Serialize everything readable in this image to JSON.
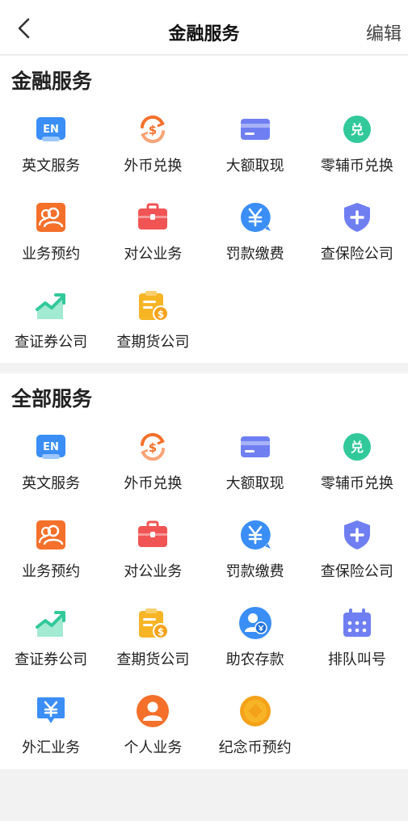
{
  "header": {
    "title": "金融服务",
    "edit_label": "编辑"
  },
  "sections": [
    {
      "title": "金融服务",
      "items": [
        {
          "label": "英文服务",
          "icon": "en-icon"
        },
        {
          "label": "外币兑换",
          "icon": "currency-exchange-icon"
        },
        {
          "label": "大额取现",
          "icon": "card-icon"
        },
        {
          "label": "零辅币兑换",
          "icon": "coin-exchange-icon"
        },
        {
          "label": "业务预约",
          "icon": "users-icon"
        },
        {
          "label": "对公业务",
          "icon": "briefcase-icon"
        },
        {
          "label": "罚款缴费",
          "icon": "yen-chat-icon"
        },
        {
          "label": "查保险公司",
          "icon": "shield-plus-icon"
        },
        {
          "label": "查证券公司",
          "icon": "trend-up-icon"
        },
        {
          "label": "查期货公司",
          "icon": "clipboard-dollar-icon"
        }
      ]
    },
    {
      "title": "全部服务",
      "items": [
        {
          "label": "英文服务",
          "icon": "en-icon"
        },
        {
          "label": "外币兑换",
          "icon": "currency-exchange-icon"
        },
        {
          "label": "大额取现",
          "icon": "card-icon"
        },
        {
          "label": "零辅币兑换",
          "icon": "coin-exchange-icon"
        },
        {
          "label": "业务预约",
          "icon": "users-icon"
        },
        {
          "label": "对公业务",
          "icon": "briefcase-icon"
        },
        {
          "label": "罚款缴费",
          "icon": "yen-chat-icon"
        },
        {
          "label": "查保险公司",
          "icon": "shield-plus-icon"
        },
        {
          "label": "查证券公司",
          "icon": "trend-up-icon"
        },
        {
          "label": "查期货公司",
          "icon": "clipboard-dollar-icon"
        },
        {
          "label": "助农存款",
          "icon": "farmer-deposit-icon"
        },
        {
          "label": "排队叫号",
          "icon": "calendar-icon"
        },
        {
          "label": "外汇业务",
          "icon": "yen-tag-icon"
        },
        {
          "label": "个人业务",
          "icon": "person-icon"
        },
        {
          "label": "纪念币预约",
          "icon": "coin-icon"
        }
      ]
    }
  ],
  "icon_text": {
    "en": "EN",
    "coin_exchange": "兑"
  },
  "colors": {
    "blue": "#3a8ef6",
    "orange": "#f4702b",
    "purple": "#6f7ff2",
    "green": "#32c99a",
    "red": "#f15454",
    "yellow": "#f7b526"
  }
}
